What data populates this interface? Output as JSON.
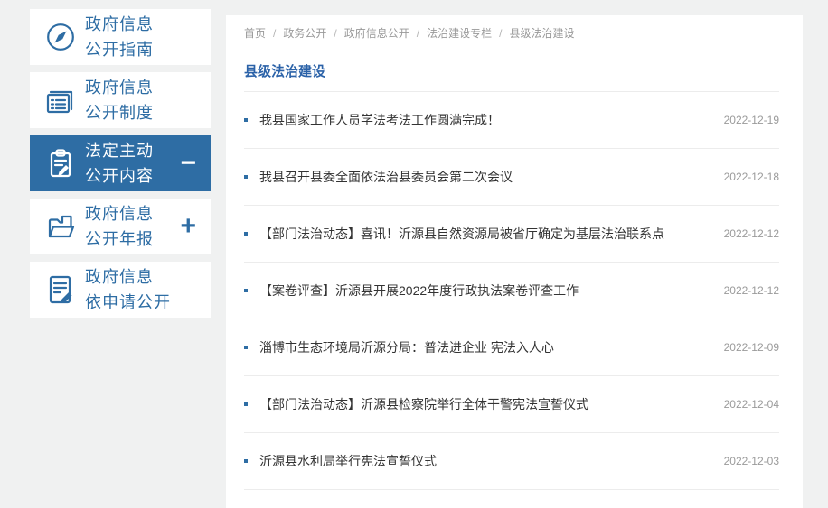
{
  "colors": {
    "accent_blue": "#2e6da4",
    "title_blue": "#2b62a8",
    "page_bg": "#f0f1f1",
    "text_dark": "#333333",
    "text_muted": "#999999"
  },
  "sidebar": {
    "items": [
      {
        "line1": "政府信息",
        "line2": "公开指南",
        "icon": "compass-icon",
        "active": false,
        "expand": ""
      },
      {
        "line1": "政府信息",
        "line2": "公开制度",
        "icon": "list-document-icon",
        "active": false,
        "expand": ""
      },
      {
        "line1": "法定主动",
        "line2": "公开内容",
        "icon": "clipboard-pen-icon",
        "active": true,
        "expand": "−"
      },
      {
        "line1": "政府信息",
        "line2": "公开年报",
        "icon": "folder-document-icon",
        "active": false,
        "expand": "+"
      },
      {
        "line1": "政府信息",
        "line2": "依申请公开",
        "icon": "document-pen-icon",
        "active": false,
        "expand": ""
      }
    ]
  },
  "breadcrumb": {
    "separator": "/",
    "items": [
      {
        "label": "首页"
      },
      {
        "label": "政务公开"
      },
      {
        "label": "政府信息公开"
      },
      {
        "label": "法治建设专栏"
      },
      {
        "label": "县级法治建设"
      }
    ]
  },
  "main": {
    "title": "县级法治建设",
    "articles": [
      {
        "title": "我县国家工作人员学法考法工作圆满完成！",
        "date": "2022-12-19"
      },
      {
        "title": "我县召开县委全面依法治县委员会第二次会议",
        "date": "2022-12-18"
      },
      {
        "title": "【部门法治动态】喜讯！沂源县自然资源局被省厅确定为基层法治联系点",
        "date": "2022-12-12"
      },
      {
        "title": "【案卷评查】沂源县开展2022年度行政执法案卷评查工作",
        "date": "2022-12-12"
      },
      {
        "title": "淄博市生态环境局沂源分局：普法进企业 宪法入人心",
        "date": "2022-12-09"
      },
      {
        "title": "【部门法治动态】沂源县检察院举行全体干警宪法宣誓仪式",
        "date": "2022-12-04"
      },
      {
        "title": "沂源县水利局举行宪法宣誓仪式",
        "date": "2022-12-03"
      }
    ]
  }
}
